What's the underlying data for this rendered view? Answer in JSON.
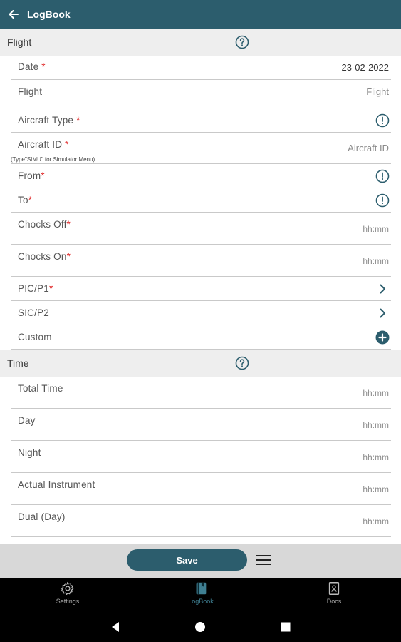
{
  "app_bar": {
    "title": "LogBook"
  },
  "flight_section": {
    "title": "Flight",
    "rows": {
      "date": {
        "label": "Date",
        "value": "23-02-2022"
      },
      "flight": {
        "label": "Flight",
        "placeholder": "Flight"
      },
      "aircraft_type": {
        "label": "Aircraft Type"
      },
      "aircraft_id": {
        "label": "Aircraft ID",
        "hint": "(Type\"SIMU\" for Simulator Menu)",
        "placeholder": "Aircraft ID"
      },
      "from": {
        "label": "From"
      },
      "to": {
        "label": "To"
      },
      "chocks_off": {
        "label": "Chocks Off",
        "placeholder": "hh:mm"
      },
      "chocks_on": {
        "label": "Chocks On",
        "placeholder": "hh:mm"
      },
      "pic": {
        "label": "PIC/P1"
      },
      "sic": {
        "label": "SIC/P2"
      },
      "custom": {
        "label": "Custom"
      }
    }
  },
  "time_section": {
    "title": "Time",
    "rows": {
      "total_time": {
        "label": "Total Time",
        "placeholder": "hh:mm"
      },
      "day": {
        "label": "Day",
        "placeholder": "hh:mm"
      },
      "night": {
        "label": "Night",
        "placeholder": "hh:mm"
      },
      "actual_instrument": {
        "label": "Actual Instrument",
        "placeholder": "hh:mm"
      },
      "dual_day": {
        "label": "Dual (Day)",
        "placeholder": "hh:mm"
      }
    }
  },
  "required_marker": "*",
  "bottom_bar": {
    "save_label": "Save"
  },
  "bottom_nav": {
    "items": [
      {
        "label": "Settings",
        "icon": "gear-icon"
      },
      {
        "label": "LogBook",
        "icon": "logbook-icon",
        "active": true
      },
      {
        "label": "Docs",
        "icon": "docs-icon"
      }
    ]
  },
  "colors": {
    "primary": "#2c5d6d",
    "required": "#e02b2b",
    "section_bg": "#eeeeee",
    "nav_active": "#3f7f92"
  }
}
